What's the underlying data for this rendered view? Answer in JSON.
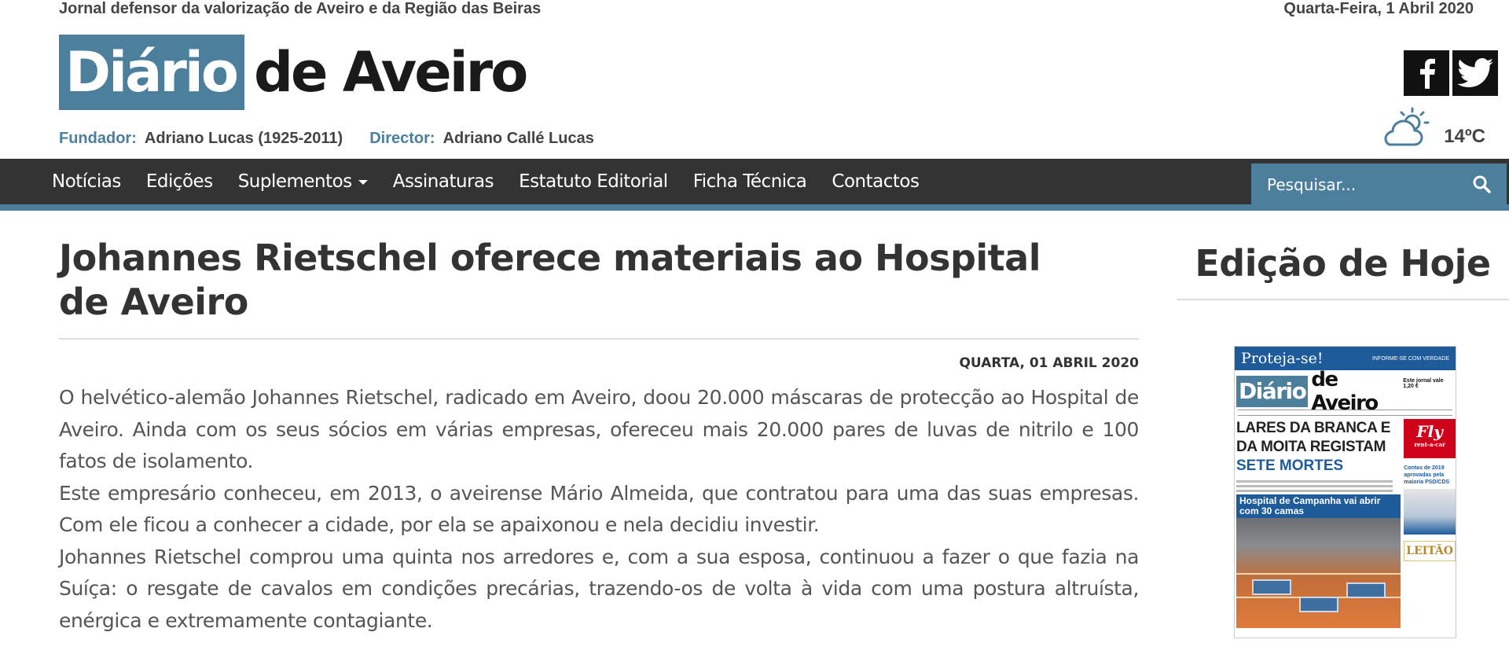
{
  "header": {
    "tagline": "Jornal defensor da valorização de Aveiro e da Região das Beiras",
    "date": "Quarta-Feira, 1 Abril 2020",
    "logo_box": "Diário",
    "logo_rest": "de Aveiro",
    "founder_label": "Fundador:",
    "founder_name": "Adriano Lucas (1925-2011)",
    "director_label": "Director:",
    "director_name": "Adriano Callé Lucas",
    "weather_temp": "14ºC",
    "weather_icon": "partly-cloudy-icon",
    "social": [
      "facebook-icon",
      "twitter-icon"
    ]
  },
  "nav": {
    "items": [
      "Notícias",
      "Edições",
      "Suplementos",
      "Assinaturas",
      "Estatuto Editorial",
      "Ficha Técnica",
      "Contactos"
    ],
    "search_placeholder": "Pesquisar..."
  },
  "article": {
    "title": "Johannes Rietschel oferece materiais ao Hospital de Aveiro",
    "date": "QUARTA, 01 ABRIL 2020",
    "paragraphs": [
      "O helvético-alemão Johannes Rietschel, radicado em Aveiro, doou 20.000 máscaras de protecção ao Hospital de Aveiro. Ainda com os seus sócios em várias empresas, ofereceu mais 20.000 pares de luvas de nitrilo e 100 fatos de isolamento.",
      "Este empresário conheceu, em 2013, o aveirense Mário Almeida, que contratou para uma das suas empresas. Com ele ficou a conhecer a cidade, por ela se apaixonou e nela decidiu investir.",
      "Johannes Rietschel comprou uma quinta nos arredores e, com a sua esposa, continuou a fazer o que fazia na Suíça: o resgate de cavalos em condições precárias, trazendo-os de volta à vida com uma postura altruísta, enérgica e extremamente contagiante."
    ]
  },
  "sidebar": {
    "title": "Edição de Hoje",
    "cover": {
      "banner": "Proteja-se!",
      "banner_right": "INFORME-SE COM VERDADE",
      "logo_box": "Diário",
      "logo_rest": "de Aveiro",
      "price": "Este jornal vale 1,20 €",
      "headline_1": "LARES DA BRANCA E DA MOITA REGISTAM",
      "headline_2": "SETE MORTES",
      "ad": "Fly",
      "ad_sub": "rent-a-car",
      "photo_title": "Hospital de Campanha vai abrir com 30 camas",
      "side_text": "Contas de 2019 aprovadas pela maioria PSD/CDS",
      "ad2": "LEITÃO"
    }
  }
}
